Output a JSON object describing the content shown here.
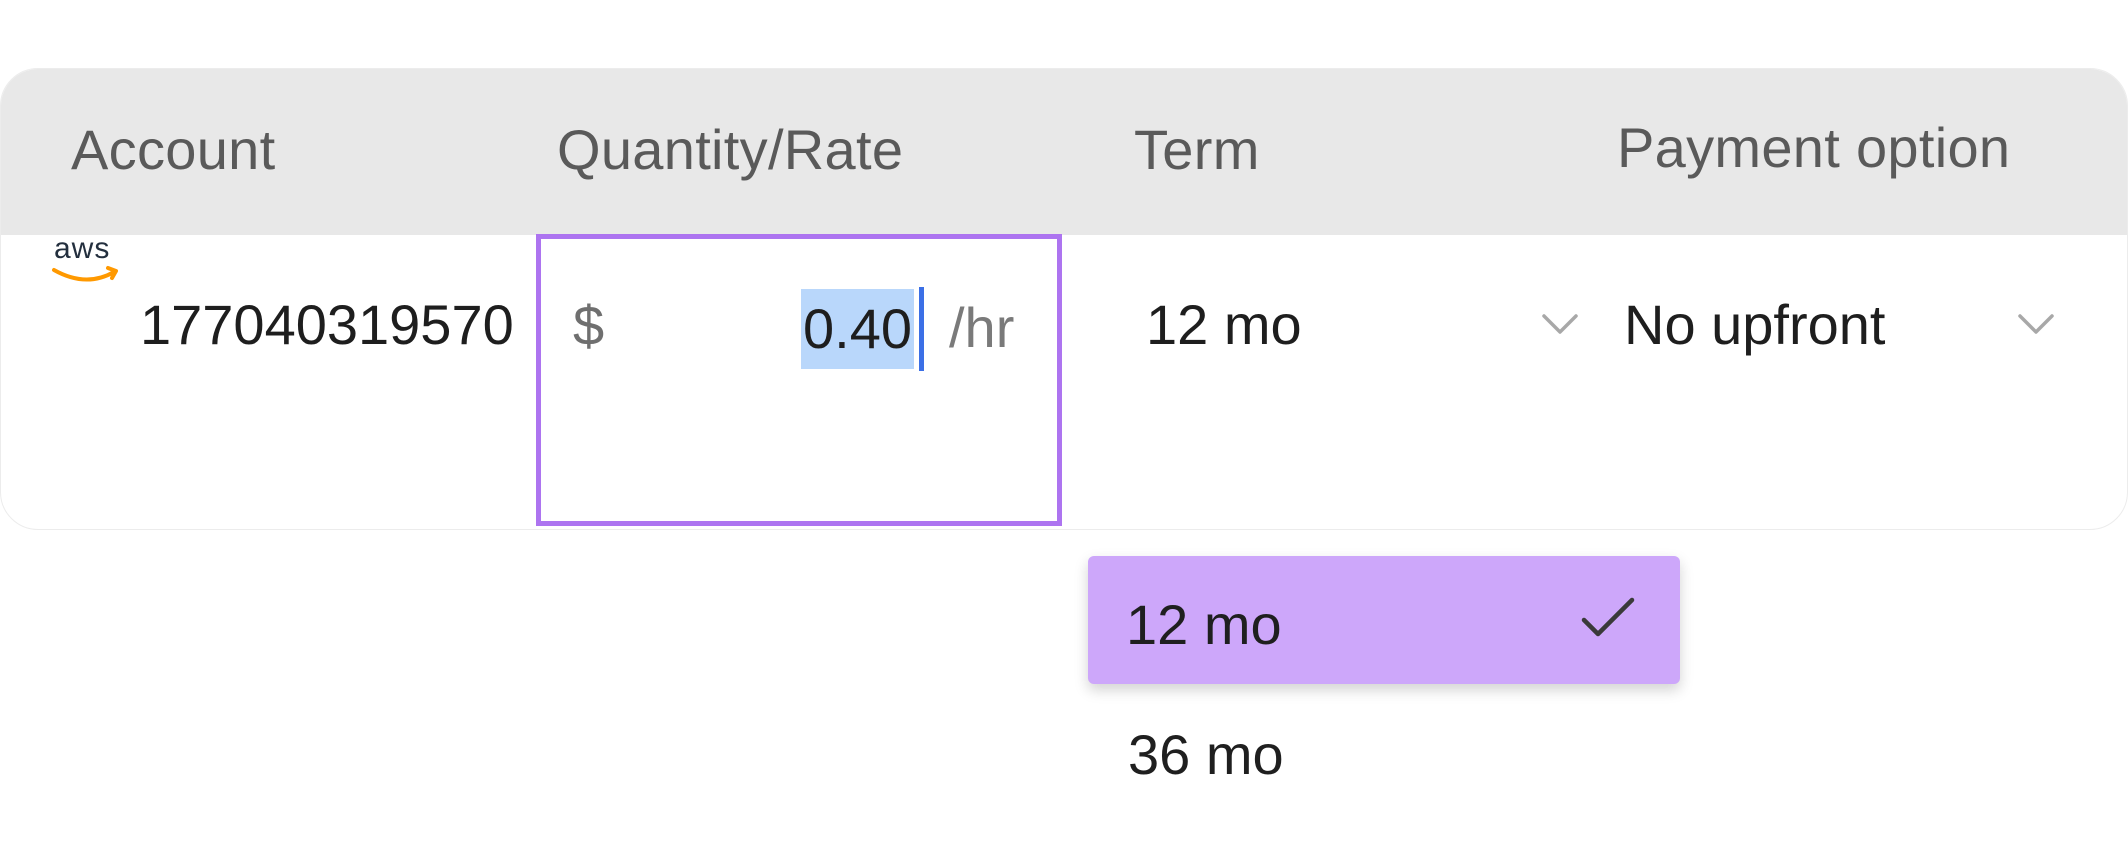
{
  "table": {
    "headers": {
      "account": "Account",
      "quantity_rate": "Quantity/Rate",
      "term": "Term",
      "payment_option": "Payment option"
    },
    "row": {
      "provider_logo": "aws",
      "account_id": "177040319570",
      "rate": {
        "currency_symbol": "$",
        "value": "0.40",
        "unit": "/hr"
      },
      "term": {
        "selected": "12 mo"
      },
      "payment_option": {
        "selected": "No upfront"
      }
    }
  },
  "term_dropdown": {
    "options": [
      {
        "label": "12 mo",
        "selected": true
      },
      {
        "label": "36 mo",
        "selected": false
      }
    ]
  },
  "icons": {
    "chevron": "chevron-down-icon",
    "check": "check-icon",
    "logo": "aws-logo"
  },
  "colors": {
    "focus_border": "#ad74f0",
    "selection_highlight": "#b9d7fb",
    "caret": "#3b6fe6",
    "selected_option_bg": "#cda7fa",
    "header_bg": "#e8e8e8",
    "aws_smile": "#ff9900"
  }
}
